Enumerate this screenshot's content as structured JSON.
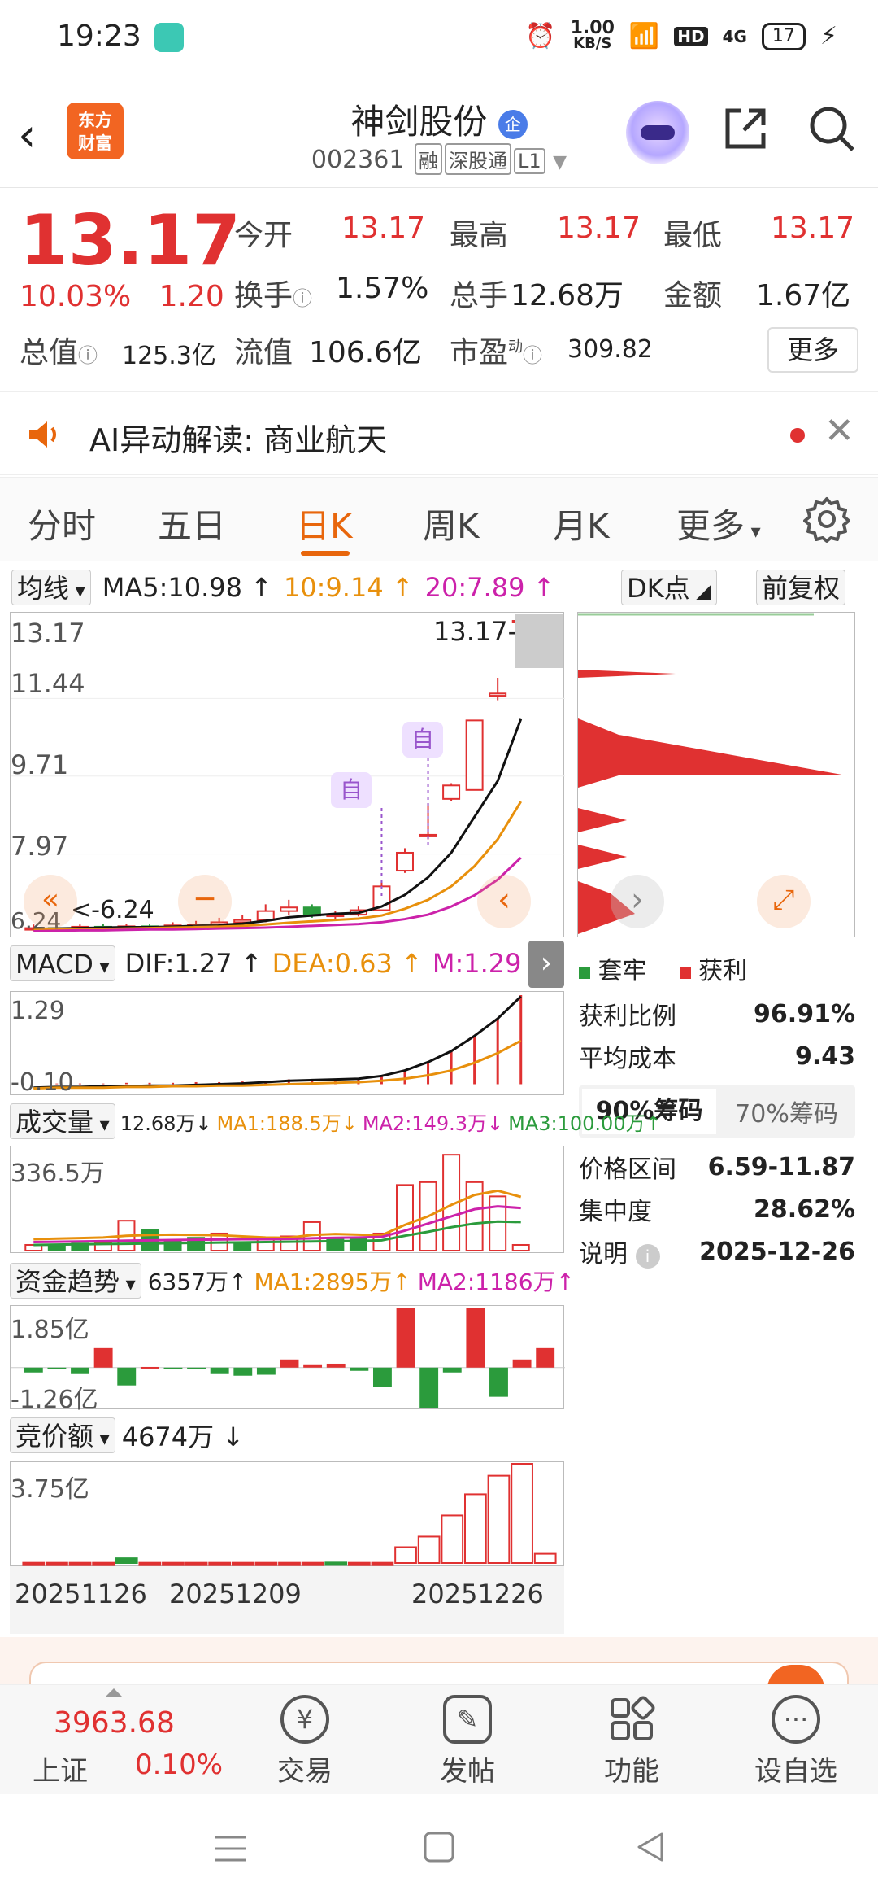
{
  "status_bar": {
    "time": "19:23",
    "net_speed_value": "1.00",
    "net_speed_unit": "KB/S",
    "hd": "HD",
    "signal": "4G",
    "battery": "17"
  },
  "header": {
    "logo_line1": "东方",
    "logo_line2": "财富",
    "title": "神剑股份",
    "title_badge": "企",
    "code": "002361",
    "tags": [
      "融",
      "深股通",
      "L1"
    ]
  },
  "quote": {
    "price": "13.17",
    "change_pct": "10.03%",
    "change_amt": "1.20",
    "open_label": "今开",
    "open": "13.17",
    "high_label": "最高",
    "high": "13.17",
    "low_label": "最低",
    "low": "13.17",
    "turnover_label": "换手",
    "turnover": "1.57%",
    "volume_label": "总手",
    "volume": "12.68万",
    "amount_label": "金额",
    "amount": "1.67亿",
    "mktcap_label": "总值",
    "mktcap": "125.3亿",
    "float_label": "流值",
    "float": "106.6亿",
    "pe_label": "市盈",
    "pe_sup": "动",
    "pe": "309.82",
    "more": "更多"
  },
  "ai_bar": {
    "text": "AI异动解读:  商业航天"
  },
  "tabs": [
    "分时",
    "五日",
    "日K",
    "周K",
    "月K",
    "更多"
  ],
  "active_tab": "日K",
  "kline": {
    "ma_dropdown": "均线",
    "ma5": "MA5:10.98",
    "ma10": "10:9.14",
    "ma20": "20:7.89",
    "dk": "DK点",
    "fq": "前复权",
    "y_labels": [
      "13.17",
      "11.44",
      "9.71",
      "7.97",
      "6.24"
    ],
    "last_price_tag": "13.17->",
    "low_tag": "<-6.24",
    "markers": [
      "自",
      "自"
    ],
    "candles": [
      {
        "o": 6.3,
        "c": 6.32,
        "h": 6.4,
        "l": 6.25
      },
      {
        "o": 6.32,
        "c": 6.31,
        "h": 6.38,
        "l": 6.26
      },
      {
        "o": 6.31,
        "c": 6.35,
        "h": 6.4,
        "l": 6.28
      },
      {
        "o": 6.35,
        "c": 6.33,
        "h": 6.42,
        "l": 6.3
      },
      {
        "o": 6.33,
        "c": 6.36,
        "h": 6.41,
        "l": 6.3
      },
      {
        "o": 6.36,
        "c": 6.34,
        "h": 6.4,
        "l": 6.31
      },
      {
        "o": 6.34,
        "c": 6.38,
        "h": 6.45,
        "l": 6.32
      },
      {
        "o": 6.38,
        "c": 6.4,
        "h": 6.48,
        "l": 6.35
      },
      {
        "o": 6.4,
        "c": 6.45,
        "h": 6.55,
        "l": 6.38
      },
      {
        "o": 6.45,
        "c": 6.5,
        "h": 6.62,
        "l": 6.42
      },
      {
        "o": 6.5,
        "c": 6.7,
        "h": 6.85,
        "l": 6.45
      },
      {
        "o": 6.7,
        "c": 6.78,
        "h": 6.95,
        "l": 6.6
      },
      {
        "o": 6.78,
        "c": 6.6,
        "h": 6.85,
        "l": 6.55
      },
      {
        "o": 6.6,
        "c": 6.62,
        "h": 6.7,
        "l": 6.5
      },
      {
        "o": 6.62,
        "c": 6.72,
        "h": 6.8,
        "l": 6.58
      },
      {
        "o": 6.72,
        "c": 7.25,
        "h": 7.35,
        "l": 6.7
      },
      {
        "o": 7.6,
        "c": 8.0,
        "h": 8.1,
        "l": 7.55
      },
      {
        "o": 8.4,
        "c": 8.4,
        "h": 9.1,
        "l": 8.3
      },
      {
        "o": 9.2,
        "c": 9.5,
        "h": 9.55,
        "l": 9.15
      },
      {
        "o": 9.4,
        "c": 10.95,
        "h": 10.95,
        "l": 9.4
      },
      {
        "o": 11.5,
        "c": 11.55,
        "h": 11.9,
        "l": 11.4
      },
      {
        "o": 13.17,
        "c": 13.17,
        "h": 13.17,
        "l": 13.17
      }
    ],
    "ma5_values": [
      6.3,
      6.31,
      6.32,
      6.33,
      6.34,
      6.34,
      6.35,
      6.37,
      6.39,
      6.42,
      6.48,
      6.56,
      6.6,
      6.64,
      6.66,
      6.8,
      7.06,
      7.45,
      8.0,
      8.8,
      9.6,
      10.98
    ],
    "ma10_values": [
      6.28,
      6.29,
      6.3,
      6.3,
      6.31,
      6.32,
      6.33,
      6.34,
      6.35,
      6.37,
      6.4,
      6.44,
      6.47,
      6.5,
      6.53,
      6.6,
      6.75,
      6.95,
      7.25,
      7.7,
      8.3,
      9.14
    ],
    "ma20_values": [
      6.25,
      6.26,
      6.27,
      6.27,
      6.28,
      6.29,
      6.29,
      6.3,
      6.31,
      6.32,
      6.33,
      6.35,
      6.37,
      6.39,
      6.41,
      6.45,
      6.52,
      6.62,
      6.8,
      7.05,
      7.4,
      7.89
    ],
    "y_min": 6.24,
    "y_max": 13.17
  },
  "chip": {
    "legend_trapped": "套牢",
    "legend_profit": "获利",
    "profit_ratio_label": "获利比例",
    "profit_ratio": "96.91%",
    "avg_cost_label": "平均成本",
    "avg_cost": "9.43",
    "tab_90": "90%筹码",
    "tab_70": "70%筹码",
    "range_label": "价格区间",
    "range": "6.59-11.87",
    "concentration_label": "集中度",
    "concentration": "28.62%",
    "note_label": "说明",
    "note_date": "2025-12-26"
  },
  "macd": {
    "dropdown": "MACD",
    "dif": "DIF:1.27",
    "dea": "DEA:0.63",
    "m": "M:1.29",
    "y_top": "1.29",
    "y_bottom": "-0.10",
    "hist": [
      0.0,
      0.01,
      0.01,
      0.01,
      0.02,
      0.02,
      0.02,
      0.03,
      0.03,
      0.04,
      0.05,
      0.07,
      0.06,
      0.06,
      0.07,
      0.12,
      0.2,
      0.32,
      0.48,
      0.7,
      0.95,
      1.29
    ],
    "dif_values": [
      -0.05,
      -0.04,
      -0.04,
      -0.03,
      -0.03,
      -0.02,
      -0.02,
      -0.01,
      0.0,
      0.01,
      0.03,
      0.05,
      0.06,
      0.07,
      0.08,
      0.12,
      0.2,
      0.32,
      0.48,
      0.7,
      0.95,
      1.27
    ],
    "dea_values": [
      -0.06,
      -0.05,
      -0.05,
      -0.05,
      -0.04,
      -0.04,
      -0.03,
      -0.03,
      -0.02,
      -0.02,
      -0.01,
      0.0,
      0.01,
      0.02,
      0.03,
      0.05,
      0.08,
      0.13,
      0.2,
      0.31,
      0.45,
      0.63
    ]
  },
  "volume": {
    "dropdown": "成交量",
    "vol": "12.68万",
    "ma1": "MA1:188.5万",
    "ma2": "MA2:149.3万",
    "ma3": "MA3:100.00万",
    "y_top": "336.5万",
    "bars": [
      {
        "v": 20,
        "up": true
      },
      {
        "v": 18,
        "up": false
      },
      {
        "v": 25,
        "up": false
      },
      {
        "v": 30,
        "up": true
      },
      {
        "v": 105,
        "up": true
      },
      {
        "v": 72,
        "up": false
      },
      {
        "v": 32,
        "up": false
      },
      {
        "v": 45,
        "up": false
      },
      {
        "v": 60,
        "up": true
      },
      {
        "v": 28,
        "up": false
      },
      {
        "v": 40,
        "up": true
      },
      {
        "v": 50,
        "up": true
      },
      {
        "v": 100,
        "up": true
      },
      {
        "v": 45,
        "up": false
      },
      {
        "v": 40,
        "up": false
      },
      {
        "v": 60,
        "up": true
      },
      {
        "v": 230,
        "up": true
      },
      {
        "v": 240,
        "up": true
      },
      {
        "v": 336,
        "up": true
      },
      {
        "v": 240,
        "up": true
      },
      {
        "v": 190,
        "up": true
      },
      {
        "v": 20,
        "up": true
      }
    ],
    "ma1_values": [
      40,
      42,
      44,
      46,
      52,
      55,
      56,
      55,
      54,
      50,
      46,
      45,
      55,
      58,
      56,
      54,
      90,
      120,
      160,
      195,
      210,
      188.5
    ],
    "ma2_values": [
      30,
      31,
      32,
      33,
      35,
      36,
      37,
      38,
      39,
      40,
      40,
      41,
      43,
      45,
      46,
      48,
      70,
      95,
      120,
      145,
      155,
      149.3
    ],
    "ma3_values": [
      20,
      21,
      22,
      23,
      24,
      25,
      26,
      27,
      28,
      29,
      30,
      31,
      32,
      33,
      34,
      36,
      52,
      66,
      82,
      95,
      102,
      100
    ]
  },
  "money": {
    "dropdown": "资金趋势",
    "val": "6357万",
    "ma1": "MA1:2895万",
    "ma2": "MA2:1186万",
    "y_top": "1.85亿",
    "y_bottom": "-1.26亿",
    "bars": [
      -0.15,
      -0.05,
      -0.2,
      0.6,
      -0.55,
      0.02,
      -0.05,
      -0.02,
      -0.2,
      -0.25,
      -0.22,
      0.25,
      0.1,
      0.12,
      -0.1,
      -0.6,
      1.85,
      -1.26,
      -0.15,
      1.85,
      -0.9,
      0.25,
      0.6
    ]
  },
  "auction": {
    "dropdown": "竞价额",
    "val": "4674万",
    "y_top": "3.75亿",
    "bars": [
      {
        "v": 0.01,
        "up": true
      },
      {
        "v": 0.01,
        "up": true
      },
      {
        "v": 0.01,
        "up": true
      },
      {
        "v": 0.01,
        "up": true
      },
      {
        "v": 0.18,
        "up": false
      },
      {
        "v": 0.01,
        "up": true
      },
      {
        "v": 0.01,
        "up": true
      },
      {
        "v": 0.01,
        "up": true
      },
      {
        "v": 0.01,
        "up": true
      },
      {
        "v": 0.01,
        "up": true
      },
      {
        "v": 0.01,
        "up": true
      },
      {
        "v": 0.01,
        "up": true
      },
      {
        "v": 0.01,
        "up": true
      },
      {
        "v": 0.02,
        "up": false
      },
      {
        "v": 0.01,
        "up": true
      },
      {
        "v": 0.01,
        "up": true
      },
      {
        "v": 0.6,
        "up": true
      },
      {
        "v": 1.0,
        "up": true
      },
      {
        "v": 1.8,
        "up": true
      },
      {
        "v": 2.6,
        "up": true
      },
      {
        "v": 3.3,
        "up": true
      },
      {
        "v": 3.75,
        "up": true
      },
      {
        "v": 0.35,
        "up": true
      }
    ],
    "x_labels": [
      "20251126",
      "20251209",
      "20251226"
    ]
  },
  "bottom_nav": {
    "index_value": "3963.68",
    "index_name": "上证",
    "index_pct": "0.10%",
    "items": [
      "交易",
      "发帖",
      "功能",
      "设自选"
    ]
  },
  "colors": {
    "up": "#e03131",
    "down": "#2b9b3c",
    "accent": "#e8660c",
    "ma10": "#e8900c",
    "ma20": "#cc22aa"
  }
}
